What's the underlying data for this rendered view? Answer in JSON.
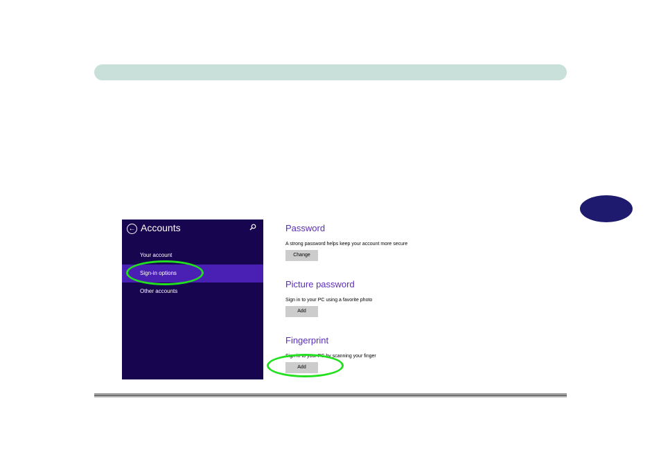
{
  "accounts_panel": {
    "title": "Accounts",
    "back_icon": "back-arrow-icon",
    "search_icon": "search-icon",
    "nav_items": [
      {
        "label": "Your account",
        "selected": false
      },
      {
        "label": "Sign-in options",
        "selected": true
      },
      {
        "label": "Other accounts",
        "selected": false
      }
    ]
  },
  "sign_in_options": {
    "password": {
      "title": "Password",
      "description": "A strong password helps keep your account more secure",
      "button_label": "Change"
    },
    "picture_password": {
      "title": "Picture password",
      "description": "Sign in to your PC using a favorite photo",
      "button_label": "Add"
    },
    "fingerprint": {
      "title": "Fingerprint",
      "description": "Sign in to your PC by scanning your finger",
      "button_label": "Add"
    }
  },
  "colors": {
    "header_bar": "#c8dfda",
    "chapter_tab": "#1e1a6e",
    "pane_background": "#180550",
    "selected_item": "#4a1fb4",
    "heading_accent": "#5a2db8",
    "annotation_highlight": "#22e01e"
  }
}
